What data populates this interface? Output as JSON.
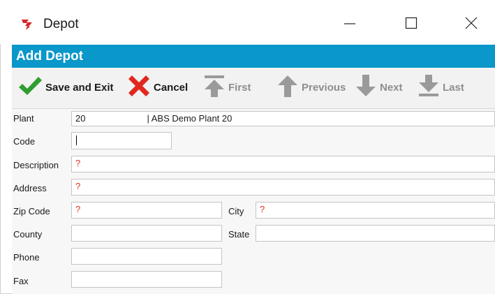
{
  "window": {
    "title": "Depot",
    "icon": "depot-app-icon",
    "controls": [
      "minimize-icon",
      "maximize-icon",
      "close-icon"
    ]
  },
  "header": {
    "title": "Add Depot",
    "color": "#0a97c9"
  },
  "toolbar": {
    "save_label": "Save and Exit",
    "cancel_label": "Cancel",
    "first_label": "First",
    "previous_label": "Previous",
    "next_label": "Next",
    "last_label": "Last",
    "save_icon": "checkmark-icon",
    "cancel_icon": "x-icon",
    "nav_disabled_color": "#8e8e8e"
  },
  "form": {
    "plant": {
      "label": "Plant",
      "code": "20",
      "name": "| ABS Demo Plant 20"
    },
    "code": {
      "label": "Code",
      "value": ""
    },
    "description": {
      "label": "Description",
      "value": "?"
    },
    "address": {
      "label": "Address",
      "value": "?"
    },
    "zip": {
      "label": "Zip Code",
      "value": "?"
    },
    "city": {
      "label": "City",
      "value": "?"
    },
    "county": {
      "label": "County",
      "value": ""
    },
    "state": {
      "label": "State",
      "value": ""
    },
    "phone": {
      "label": "Phone",
      "value": ""
    },
    "fax": {
      "label": "Fax",
      "value": ""
    },
    "required_marker_color": "#e0301e"
  }
}
